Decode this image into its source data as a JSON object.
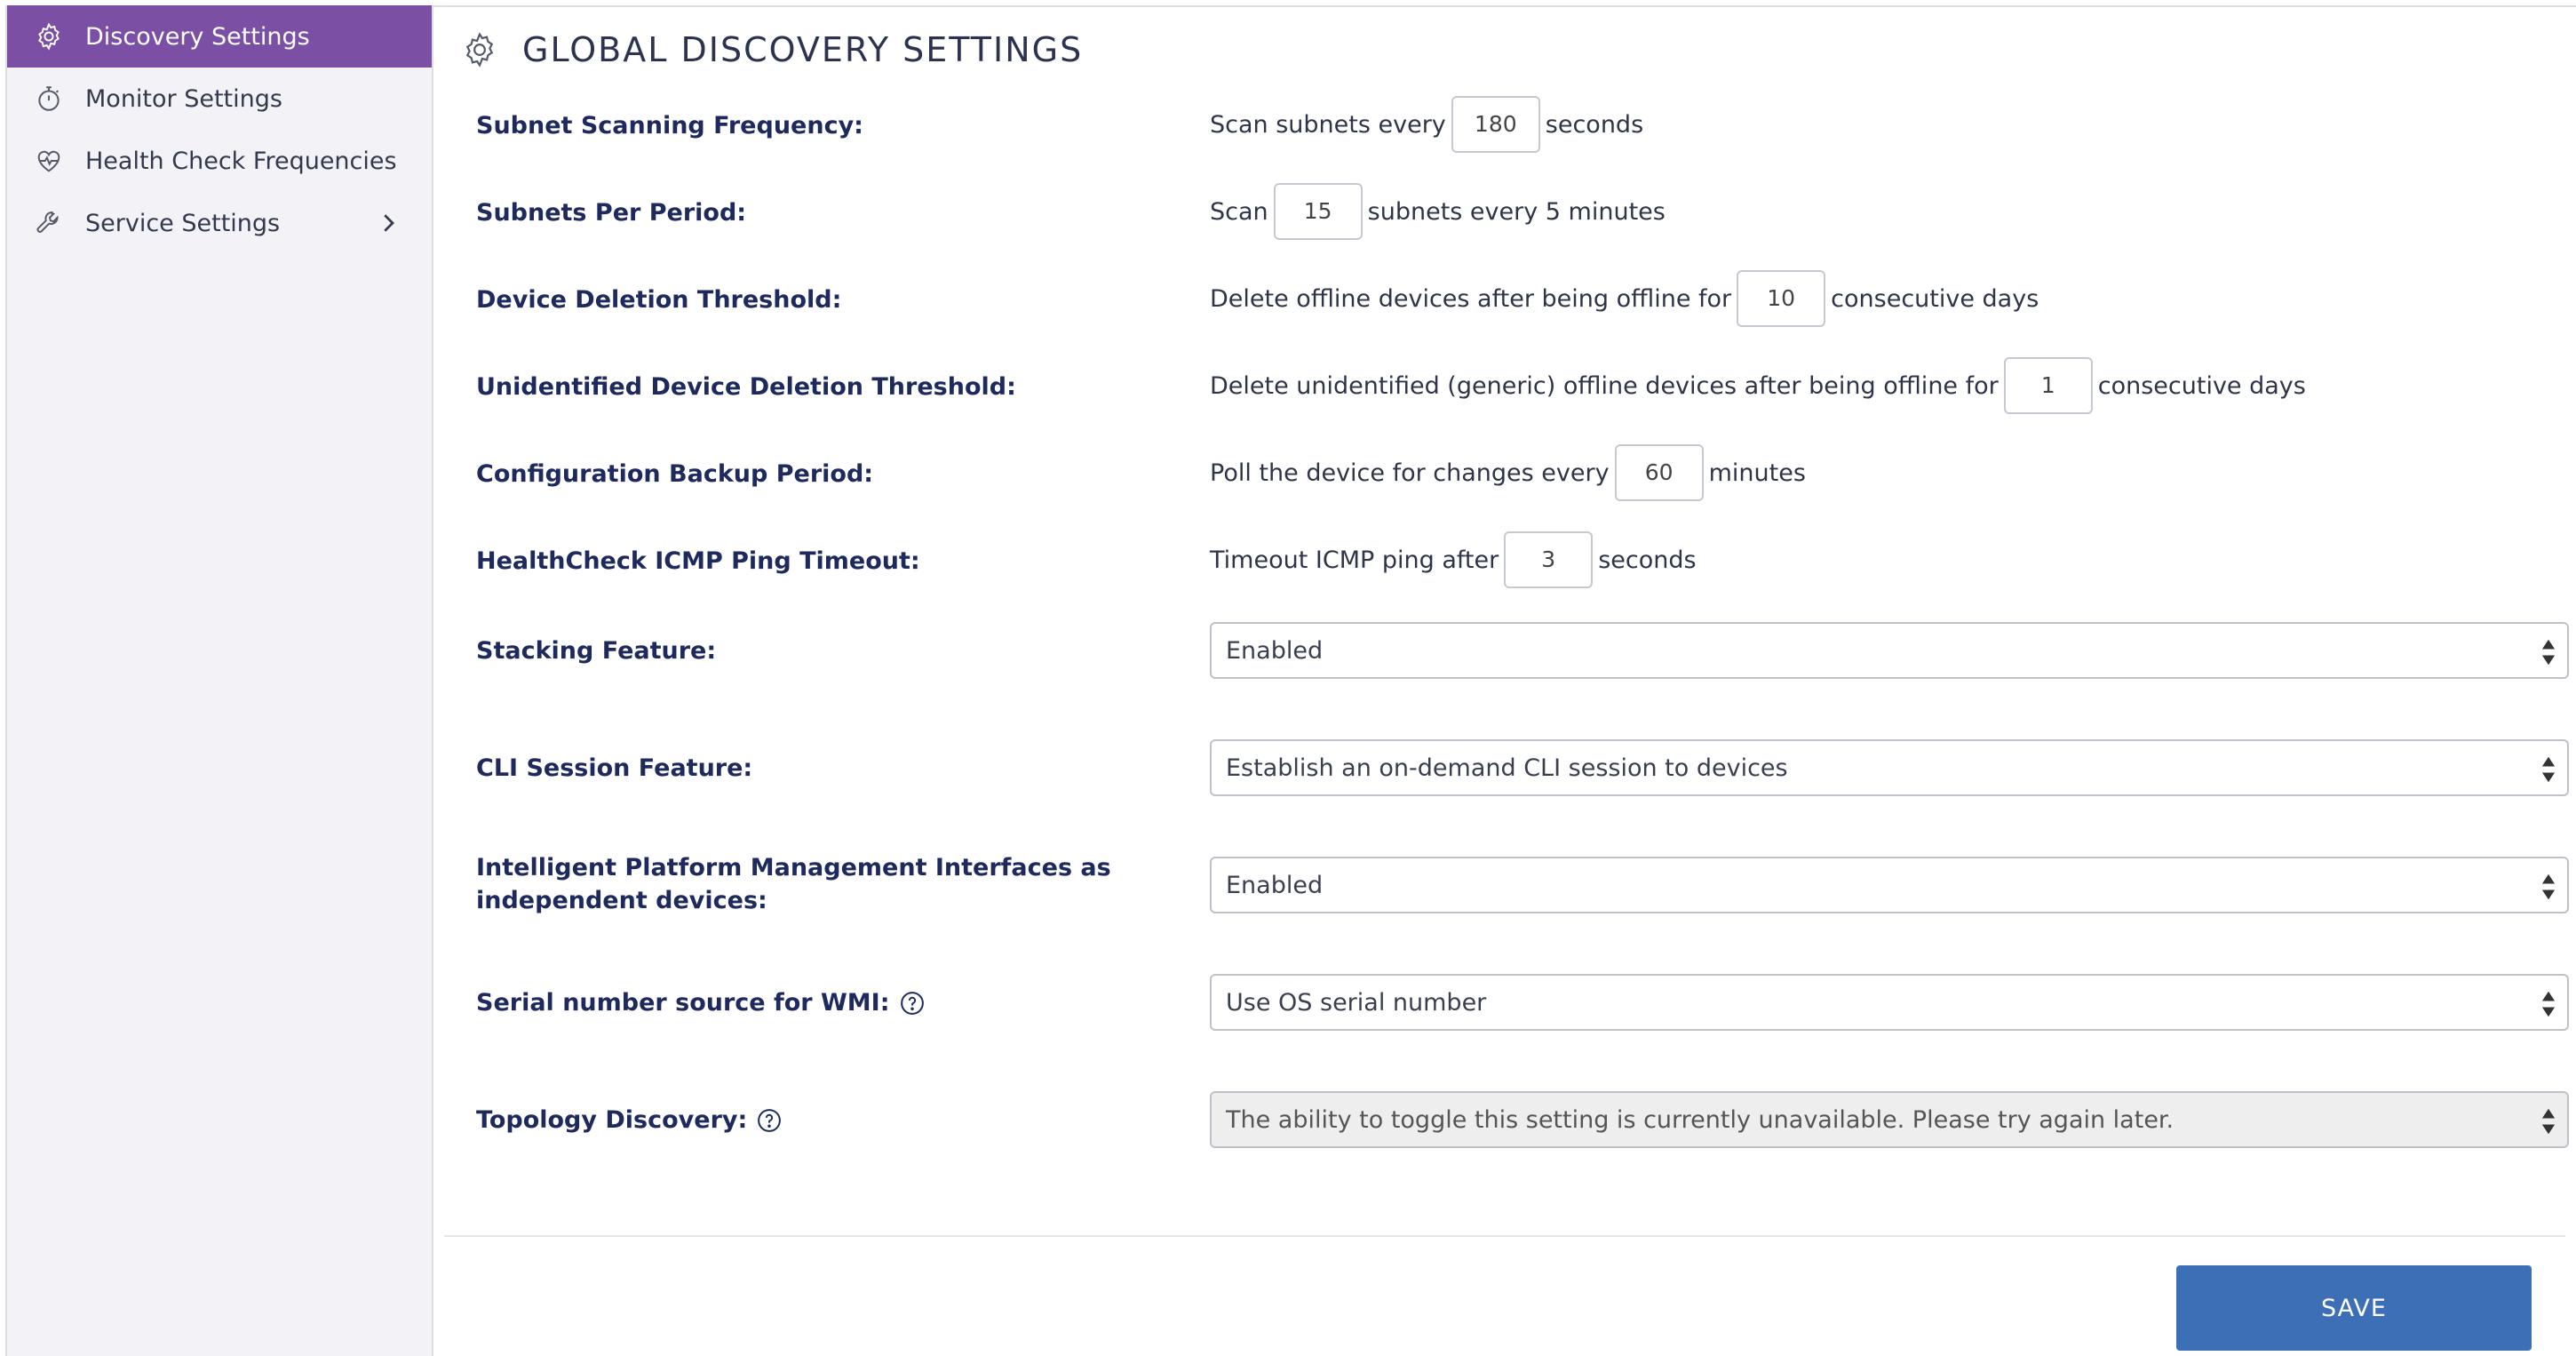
{
  "sidebar": {
    "items": [
      {
        "label": "Discovery Settings",
        "icon": "gear-icon",
        "active": true
      },
      {
        "label": "Monitor Settings",
        "icon": "stopwatch-icon"
      },
      {
        "label": "Health Check Frequencies",
        "icon": "heartbeat-icon"
      },
      {
        "label": "Service Settings",
        "icon": "wrench-icon",
        "has_submenu": true
      }
    ]
  },
  "header": {
    "title": "GLOBAL DISCOVERY SETTINGS",
    "icon": "gear-icon"
  },
  "settings": {
    "subnet_freq": {
      "label": "Subnet Scanning Frequency:",
      "prefix": "Scan subnets every",
      "value": "180",
      "suffix": "seconds"
    },
    "subnets_per_period": {
      "label": "Subnets Per Period:",
      "prefix": "Scan",
      "value": "15",
      "suffix": "subnets every 5 minutes"
    },
    "device_deletion": {
      "label": "Device Deletion Threshold:",
      "prefix": "Delete offline devices after being offline for",
      "value": "10",
      "suffix": "consecutive days"
    },
    "unidentified_deletion": {
      "label": "Unidentified Device Deletion Threshold:",
      "prefix": "Delete unidentified (generic) offline devices after being offline for",
      "value": "1",
      "suffix": "consecutive days"
    },
    "config_backup": {
      "label": "Configuration Backup Period:",
      "prefix": "Poll the device for changes every",
      "value": "60",
      "suffix": "minutes"
    },
    "icmp_timeout": {
      "label": "HealthCheck ICMP Ping Timeout:",
      "prefix": "Timeout ICMP ping after",
      "value": "3",
      "suffix": "seconds"
    },
    "stacking": {
      "label": "Stacking Feature:",
      "selected": "Enabled"
    },
    "cli_session": {
      "label": "CLI Session Feature:",
      "selected": "Establish an on-demand CLI session to devices"
    },
    "ipmi": {
      "label": "Intelligent Platform Management Interfaces as independent devices:",
      "selected": "Enabled"
    },
    "wmi_serial": {
      "label": "Serial number source for WMI:",
      "selected": "Use OS serial number",
      "help": true
    },
    "topology": {
      "label": "Topology Discovery:",
      "selected": "The ability to toggle this setting is currently unavailable. Please try again later.",
      "disabled": true,
      "help": true
    }
  },
  "footer": {
    "save_label": "SAVE"
  },
  "colors": {
    "accent": "#7a4fa4",
    "primary_button": "#3c6fb6",
    "label_text": "#1e2a5e"
  }
}
